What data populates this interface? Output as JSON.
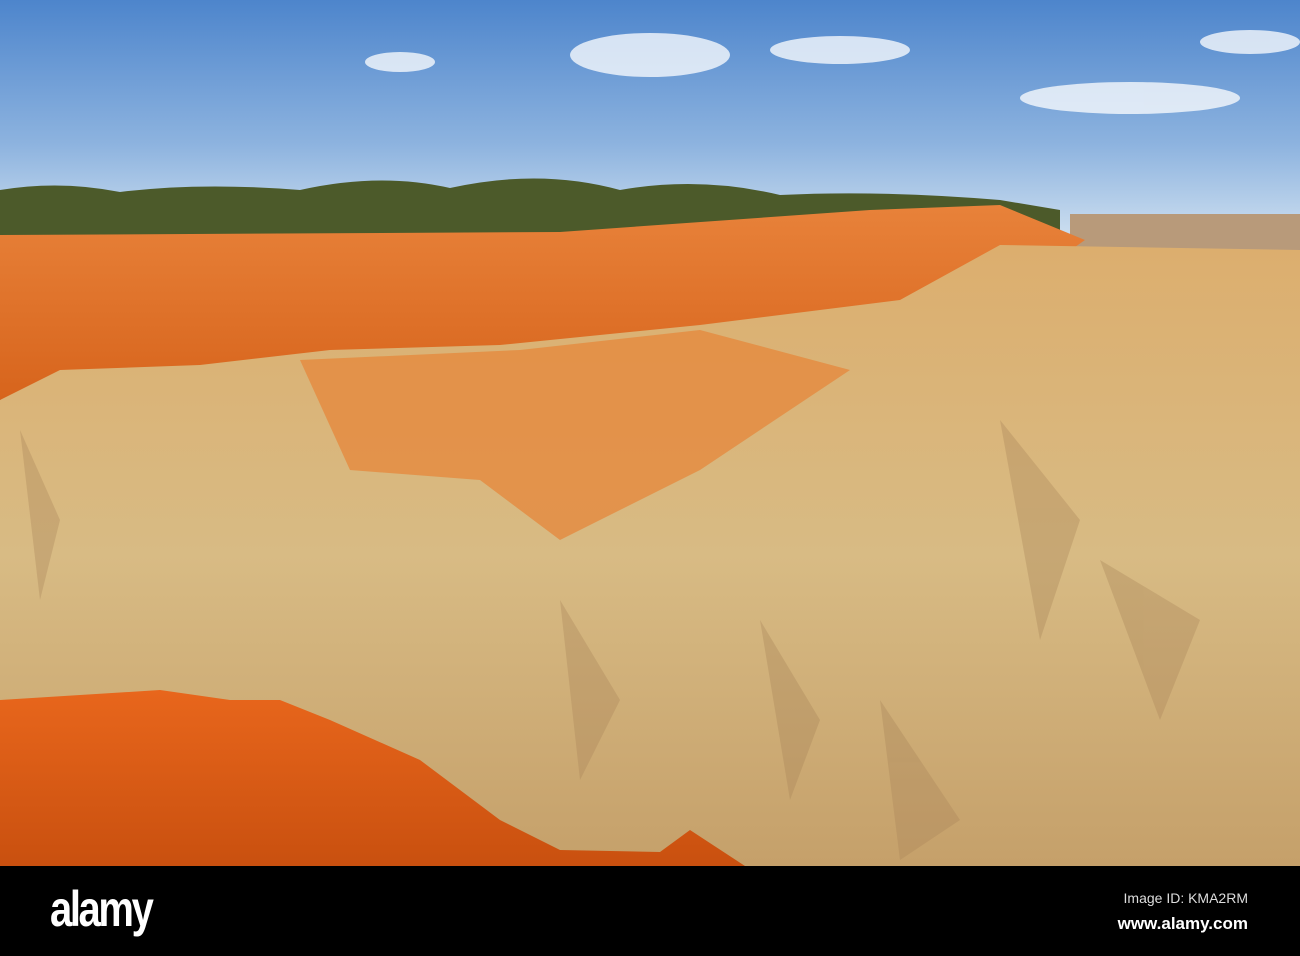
{
  "watermark": {
    "logo": "alamy",
    "image_id": "Image ID: KMA2RM",
    "url": "www.alamy.com"
  },
  "colors": {
    "sky_top": "#4d85cc",
    "sky_horizon": "#cfe0f0",
    "vegetation": "#4c5a2a",
    "cliff_orange": "#e2782c",
    "rock_pale": "#d8b77c",
    "foreground_red": "#df5f18"
  }
}
